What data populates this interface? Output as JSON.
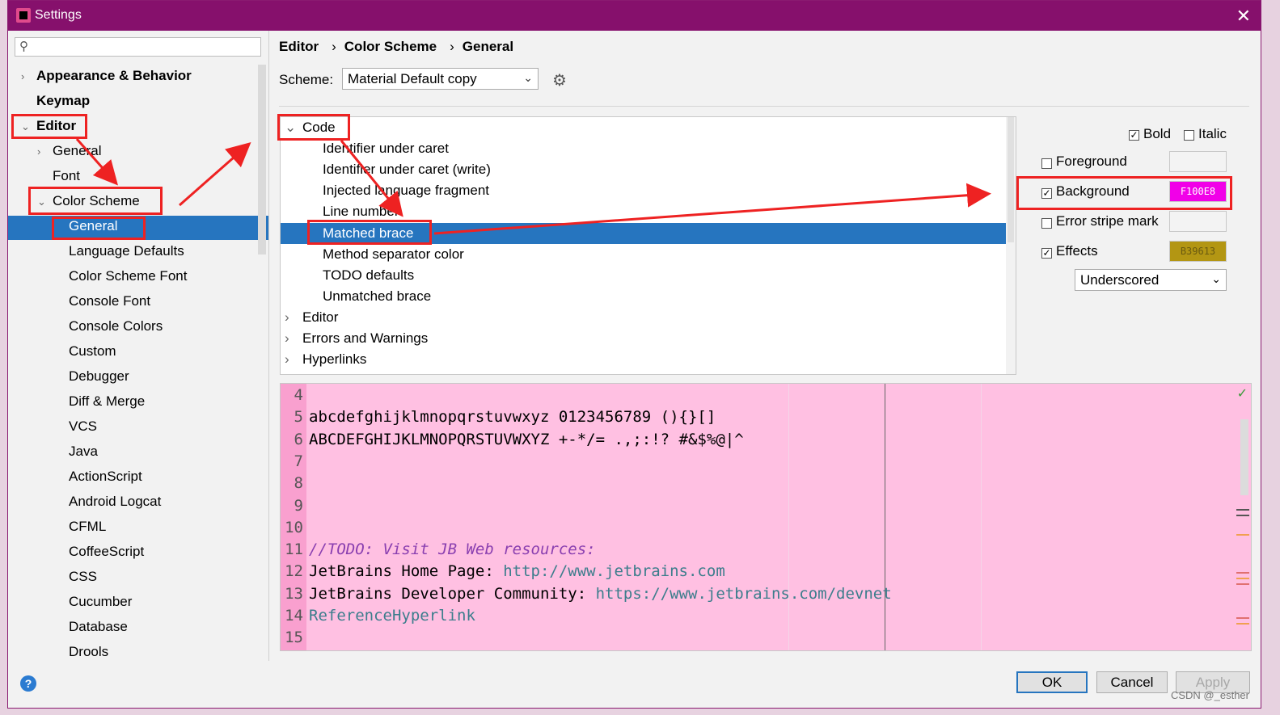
{
  "window": {
    "title": "Settings",
    "close_glyph": "✕"
  },
  "search": {
    "placeholder": "",
    "icon": "search-icon"
  },
  "sidebar": {
    "items": [
      {
        "label": "Appearance & Behavior",
        "arrow": "›"
      },
      {
        "label": "Keymap"
      },
      {
        "label": "Editor",
        "arrow": "⌄"
      },
      {
        "label": "General",
        "arrow": "›"
      },
      {
        "label": "Font"
      },
      {
        "label": "Color Scheme",
        "arrow": "⌄"
      },
      {
        "label": "General"
      },
      {
        "label": "Language Defaults"
      },
      {
        "label": "Color Scheme Font"
      },
      {
        "label": "Console Font"
      },
      {
        "label": "Console Colors"
      },
      {
        "label": "Custom"
      },
      {
        "label": "Debugger"
      },
      {
        "label": "Diff & Merge"
      },
      {
        "label": "VCS"
      },
      {
        "label": "Java"
      },
      {
        "label": "ActionScript"
      },
      {
        "label": "Android Logcat"
      },
      {
        "label": "CFML"
      },
      {
        "label": "CoffeeScript"
      },
      {
        "label": "CSS"
      },
      {
        "label": "Cucumber"
      },
      {
        "label": "Database"
      },
      {
        "label": "Drools"
      }
    ]
  },
  "breadcrumb": {
    "parts": [
      "Editor",
      "Color Scheme",
      "General"
    ],
    "separator": "›"
  },
  "scheme": {
    "label": "Scheme:",
    "value": "Material Default copy",
    "chevron": "⌄"
  },
  "code_tree": {
    "items": [
      {
        "label": "Code",
        "arrow": "⌄"
      },
      {
        "label": "Identifier under caret"
      },
      {
        "label": "Identifier under caret (write)"
      },
      {
        "label": "Injected language fragment"
      },
      {
        "label": "Line number"
      },
      {
        "label": "Matched brace"
      },
      {
        "label": "Method separator color"
      },
      {
        "label": "TODO defaults"
      },
      {
        "label": "Unmatched brace"
      },
      {
        "label": "Editor",
        "arrow": "›"
      },
      {
        "label": "Errors and Warnings",
        "arrow": "›"
      },
      {
        "label": "Hyperlinks",
        "arrow": "›"
      }
    ]
  },
  "properties": {
    "bold": {
      "label": "Bold",
      "checked": true
    },
    "italic": {
      "label": "Italic",
      "checked": false
    },
    "foreground": {
      "label": "Foreground",
      "checked": false,
      "value": ""
    },
    "background": {
      "label": "Background",
      "checked": true,
      "value": "F100E8",
      "color": "#F100E8"
    },
    "error_stripe": {
      "label": "Error stripe mark",
      "checked": false,
      "value": ""
    },
    "effects": {
      "label": "Effects",
      "checked": true,
      "value": "B39613",
      "color": "#B39613"
    },
    "effect_type": "Underscored",
    "check_glyph": "✓"
  },
  "preview": {
    "lines": [
      {
        "num": "4",
        "text": ""
      },
      {
        "num": "5",
        "text": "abcdefghijklmnopqrstuvwxyz 0123456789 (){}[]"
      },
      {
        "num": "6",
        "text": "ABCDEFGHIJKLMNOPQRSTUVWXYZ +-*/= .,;:!? #&$%@|^"
      },
      {
        "num": "7",
        "text": ""
      },
      {
        "num": "8",
        "text": ""
      },
      {
        "num": "9",
        "text": ""
      },
      {
        "num": "10",
        "text": ""
      },
      {
        "num": "11",
        "text": "//TODO: Visit JB Web resources:"
      },
      {
        "num": "12",
        "text": "JetBrains Home Page: ",
        "link": "http://www.jetbrains.com"
      },
      {
        "num": "13",
        "text": "JetBrains Developer Community: ",
        "link": "https://www.jetbrains.com/devnet"
      },
      {
        "num": "14",
        "text": "",
        "link": "ReferenceHyperlink"
      },
      {
        "num": "15",
        "text": ""
      }
    ],
    "colors": {
      "todo": "#8a3fb0",
      "link": "#3c7d8c"
    },
    "check_glyph": "✓"
  },
  "buttons": {
    "ok": "OK",
    "cancel": "Cancel",
    "apply": "Apply",
    "help": "?"
  },
  "watermark": "CSDN @_esther"
}
